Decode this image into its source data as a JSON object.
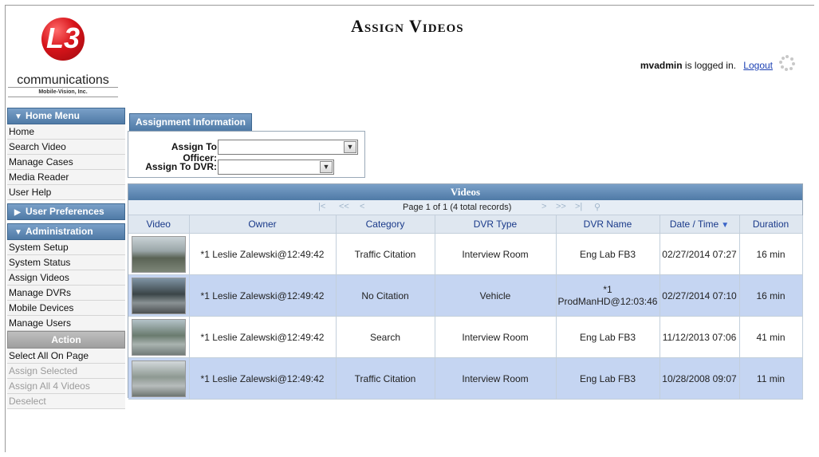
{
  "logo": {
    "mark": "L3",
    "name": "communications",
    "sub": "Mobile-Vision, Inc."
  },
  "header": {
    "title": "Assign Videos",
    "user": "mvadmin",
    "logged_text": "is logged in.",
    "logout": "Logout"
  },
  "sidebar": {
    "home_menu": {
      "label": "Home Menu",
      "items": [
        "Home",
        "Search Video",
        "Manage Cases",
        "Media Reader",
        "User Help"
      ]
    },
    "user_prefs": {
      "label": "User Preferences"
    },
    "administration": {
      "label": "Administration",
      "items": [
        "System Setup",
        "System Status",
        "Assign Videos",
        "Manage DVRs",
        "Mobile Devices",
        "Manage Users"
      ]
    },
    "action": {
      "label": "Action",
      "items": [
        "Select All On Page",
        "Assign Selected",
        "Assign All 4 Videos",
        "Deselect"
      ]
    }
  },
  "assignment": {
    "tab": "Assignment Information",
    "officer_label": "Assign To Officer:",
    "officer_value": "",
    "dvr_label": "Assign To DVR:",
    "dvr_value": ""
  },
  "videos": {
    "title": "Videos",
    "pager_text": "Page 1 of 1 (4 total records)",
    "columns": [
      "Video",
      "Owner",
      "Category",
      "DVR Type",
      "DVR Name",
      "Date / Time",
      "Duration"
    ],
    "rows": [
      {
        "owner": "*1 Leslie Zalewski@12:49:42",
        "category": "Traffic Citation",
        "dvr_type": "Interview Room",
        "dvr_name": "Eng Lab FB3",
        "datetime": "02/27/2014 07:27",
        "duration": "16 min"
      },
      {
        "owner": "*1 Leslie Zalewski@12:49:42",
        "category": "No Citation",
        "dvr_type": "Vehicle",
        "dvr_name": "*1\nProdManHD@12:03:46",
        "datetime": "02/27/2014 07:10",
        "duration": "16 min"
      },
      {
        "owner": "*1 Leslie Zalewski@12:49:42",
        "category": "Search",
        "dvr_type": "Interview Room",
        "dvr_name": "Eng Lab FB3",
        "datetime": "11/12/2013 07:06",
        "duration": "41 min"
      },
      {
        "owner": "*1 Leslie Zalewski@12:49:42",
        "category": "Traffic Citation",
        "dvr_type": "Interview Room",
        "dvr_name": "Eng Lab FB3",
        "datetime": "10/28/2008 09:07",
        "duration": "11 min"
      }
    ]
  },
  "colors": {
    "header_blue": "#5f88b3",
    "row_highlight": "#c5d5f2",
    "link_blue": "#1a3fb3",
    "logo_red": "#d7141a"
  }
}
